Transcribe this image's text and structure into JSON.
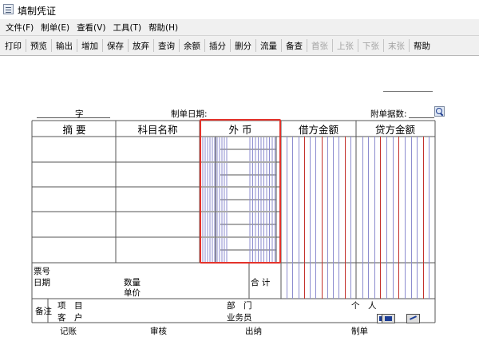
{
  "window": {
    "title": "填制凭证"
  },
  "menu": [
    {
      "label": "文件(F)"
    },
    {
      "label": "制单(E)"
    },
    {
      "label": "查看(V)"
    },
    {
      "label": "工具(T)"
    },
    {
      "label": "帮助(H)"
    }
  ],
  "toolbar": [
    {
      "label": "打印",
      "enabled": true
    },
    {
      "label": "预览",
      "enabled": true
    },
    {
      "label": "输出",
      "enabled": true
    },
    {
      "label": "增加",
      "enabled": true
    },
    {
      "label": "保存",
      "enabled": true
    },
    {
      "label": "放弃",
      "enabled": true
    },
    {
      "label": "查询",
      "enabled": true
    },
    {
      "label": "余额",
      "enabled": true
    },
    {
      "label": "插分",
      "enabled": true
    },
    {
      "label": "删分",
      "enabled": true
    },
    {
      "label": "流量",
      "enabled": true
    },
    {
      "label": "备查",
      "enabled": true
    },
    {
      "label": "首张",
      "enabled": false
    },
    {
      "label": "上张",
      "enabled": false
    },
    {
      "label": "下张",
      "enabled": false
    },
    {
      "label": "末张",
      "enabled": false
    },
    {
      "label": "帮助",
      "enabled": true
    }
  ],
  "voucher": {
    "zi_label": "字",
    "date_label": "制单日期:",
    "attachments_label": "附单据数:",
    "columns": {
      "summary": "摘 要",
      "account": "科目名称",
      "foreign_currency": "外 币",
      "debit": "借方金额",
      "credit": "贷方金额"
    },
    "footer": {
      "ticket_no": "票号",
      "date": "日期",
      "quantity": "数量",
      "unit_price": "单价",
      "total": "合 计",
      "remarks": "备注",
      "project": "项　目",
      "customer": "客　户",
      "department": "部　门",
      "salesperson": "业务员",
      "individual": "个　人"
    },
    "signatures": {
      "bookkeeping": "记账",
      "review": "审核",
      "cashier": "出纳",
      "preparer": "制单"
    }
  },
  "colors": {
    "highlight": "#e3332b",
    "grid_line": "#555555",
    "digit_line": "#8c8ccf",
    "unit_line": "#c3302a"
  }
}
